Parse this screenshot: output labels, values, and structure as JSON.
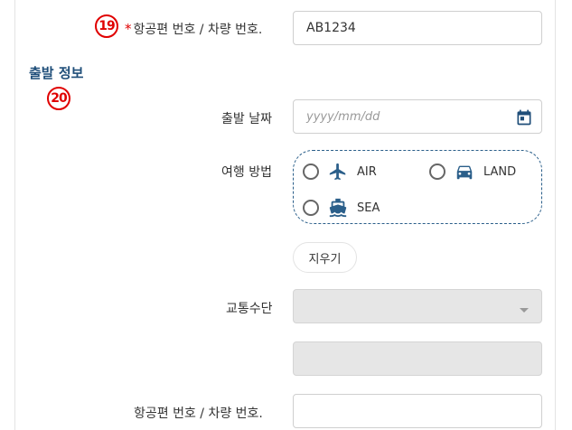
{
  "markers": {
    "m19": "19",
    "m20": "20"
  },
  "flight_number": {
    "required_mark": "*",
    "label": "항공편 번호 / 차량 번호.",
    "value": "AB1234"
  },
  "section_title": "출발 정보",
  "departure_date": {
    "label": "출발 날짜",
    "placeholder": "yyyy/mm/dd",
    "icon": "calendar-icon"
  },
  "travel_method": {
    "label": "여행 방법",
    "options": [
      {
        "label": "AIR",
        "icon": "airplane-icon",
        "selected": false
      },
      {
        "label": "LAND",
        "icon": "car-icon",
        "selected": false
      },
      {
        "label": "SEA",
        "icon": "ship-icon",
        "selected": false
      }
    ]
  },
  "clear_button": {
    "label": "지우기"
  },
  "transport": {
    "label": "교통수단",
    "value": ""
  },
  "flight_number_2": {
    "label": "항공편 번호 / 차량 번호.",
    "value": ""
  },
  "colors": {
    "accent": "#2b5f8a",
    "marker": "#e00000",
    "disabled": "#e6e6e6"
  }
}
